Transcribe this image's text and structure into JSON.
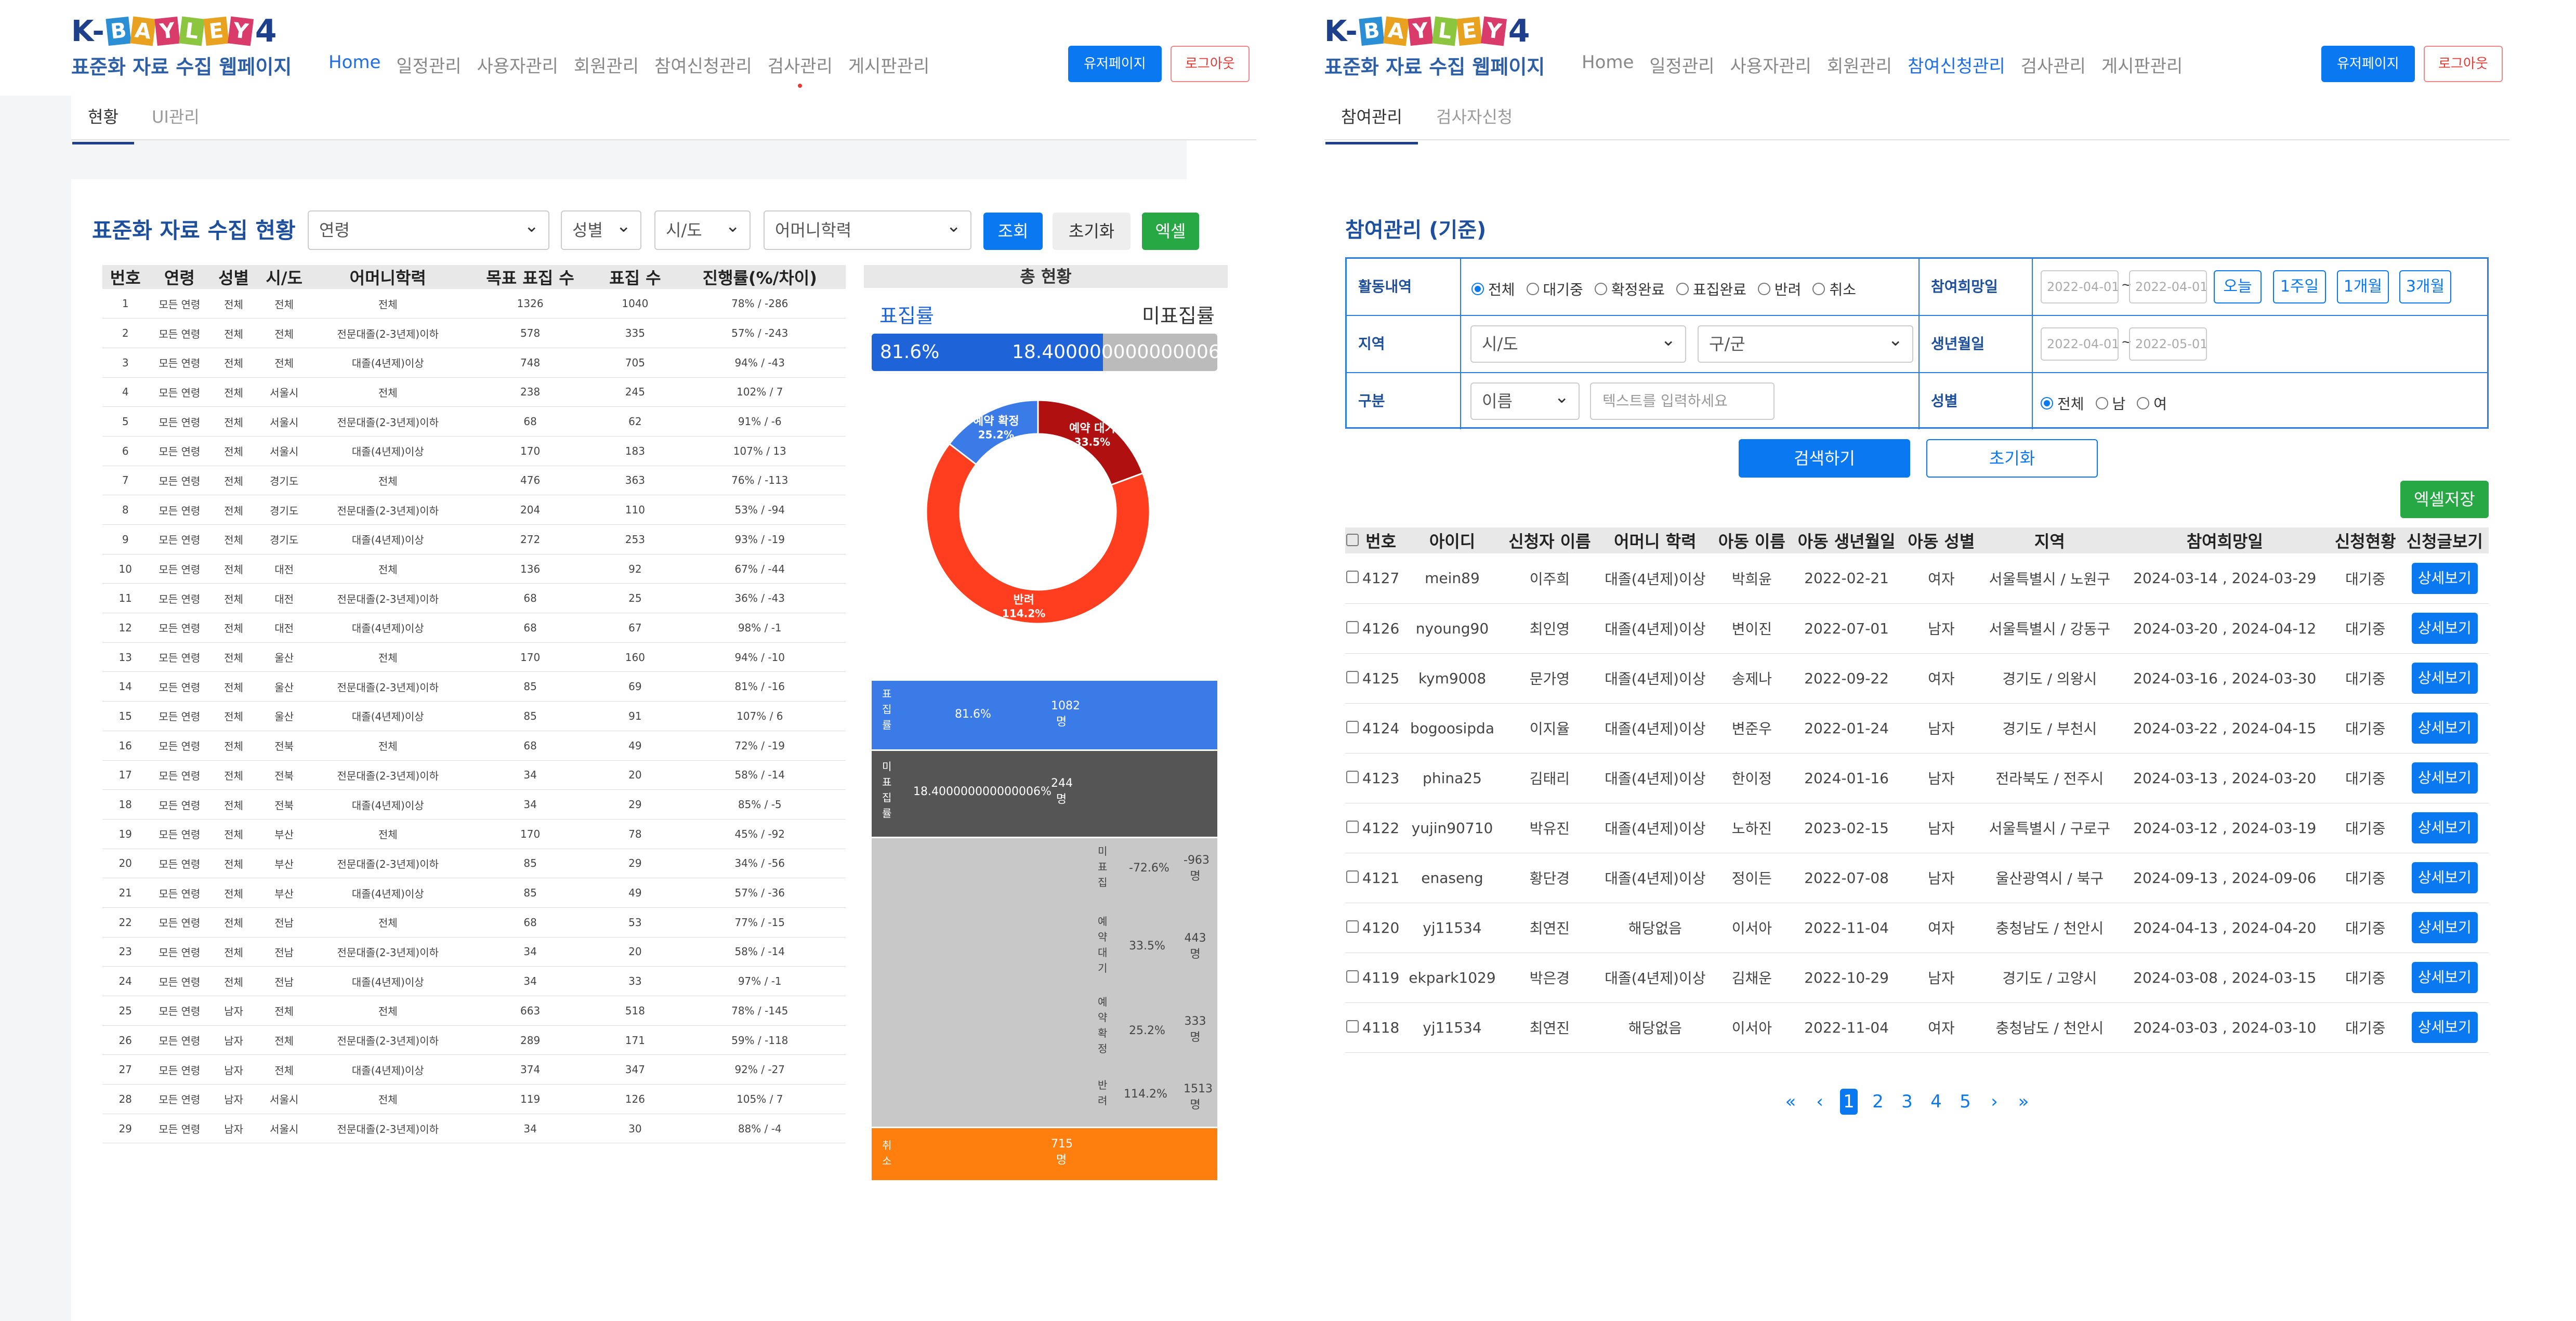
{
  "left": {
    "logo": {
      "brand": "K-BAYLEY4",
      "letters": [
        "B",
        "A",
        "Y",
        "L",
        "E",
        "Y"
      ],
      "subtitle": "표준화 자료 수집 웹페이지"
    },
    "nav": [
      "Home",
      "일정관리",
      "사용자관리",
      "회원관리",
      "참여신청관리",
      "검사관리",
      "게시판관리"
    ],
    "buttons": {
      "user_page": "유저페이지",
      "logout": "로그아웃"
    },
    "subtabs": [
      "현황",
      "UI관리"
    ],
    "title": "표준화 자료 수집 현황",
    "filters": {
      "age": "연령",
      "sex": "성별",
      "region": "시/도",
      "mother_edu": "어머니학력"
    },
    "actions": {
      "search": "조회",
      "reset": "초기화",
      "excel": "엑셀"
    },
    "table": {
      "headers": [
        "번호",
        "연령",
        "성별",
        "시/도",
        "어머니학력",
        "목표 표집 수",
        "표집 수",
        "진행률(%/차이)"
      ],
      "rows": [
        [
          "1",
          "모든 연령",
          "전체",
          "전체",
          "전체",
          "1326",
          "1040",
          "78% / -286"
        ],
        [
          "2",
          "모든 연령",
          "전체",
          "전체",
          "전문대졸(2-3년제)이하",
          "578",
          "335",
          "57% / -243"
        ],
        [
          "3",
          "모든 연령",
          "전체",
          "전체",
          "대졸(4년제)이상",
          "748",
          "705",
          "94% / -43"
        ],
        [
          "4",
          "모든 연령",
          "전체",
          "서울시",
          "전체",
          "238",
          "245",
          "102% / 7"
        ],
        [
          "5",
          "모든 연령",
          "전체",
          "서울시",
          "전문대졸(2-3년제)이하",
          "68",
          "62",
          "91% / -6"
        ],
        [
          "6",
          "모든 연령",
          "전체",
          "서울시",
          "대졸(4년제)이상",
          "170",
          "183",
          "107% / 13"
        ],
        [
          "7",
          "모든 연령",
          "전체",
          "경기도",
          "전체",
          "476",
          "363",
          "76% / -113"
        ],
        [
          "8",
          "모든 연령",
          "전체",
          "경기도",
          "전문대졸(2-3년제)이하",
          "204",
          "110",
          "53% / -94"
        ],
        [
          "9",
          "모든 연령",
          "전체",
          "경기도",
          "대졸(4년제)이상",
          "272",
          "253",
          "93% / -19"
        ],
        [
          "10",
          "모든 연령",
          "전체",
          "대전",
          "전체",
          "136",
          "92",
          "67% / -44"
        ],
        [
          "11",
          "모든 연령",
          "전체",
          "대전",
          "전문대졸(2-3년제)이하",
          "68",
          "25",
          "36% / -43"
        ],
        [
          "12",
          "모든 연령",
          "전체",
          "대전",
          "대졸(4년제)이상",
          "68",
          "67",
          "98% / -1"
        ],
        [
          "13",
          "모든 연령",
          "전체",
          "울산",
          "전체",
          "170",
          "160",
          "94% / -10"
        ],
        [
          "14",
          "모든 연령",
          "전체",
          "울산",
          "전문대졸(2-3년제)이하",
          "85",
          "69",
          "81% / -16"
        ],
        [
          "15",
          "모든 연령",
          "전체",
          "울산",
          "대졸(4년제)이상",
          "85",
          "91",
          "107% / 6"
        ],
        [
          "16",
          "모든 연령",
          "전체",
          "전북",
          "전체",
          "68",
          "49",
          "72% / -19"
        ],
        [
          "17",
          "모든 연령",
          "전체",
          "전북",
          "전문대졸(2-3년제)이하",
          "34",
          "20",
          "58% / -14"
        ],
        [
          "18",
          "모든 연령",
          "전체",
          "전북",
          "대졸(4년제)이상",
          "34",
          "29",
          "85% / -5"
        ],
        [
          "19",
          "모든 연령",
          "전체",
          "부산",
          "전체",
          "170",
          "78",
          "45% / -92"
        ],
        [
          "20",
          "모든 연령",
          "전체",
          "부산",
          "전문대졸(2-3년제)이하",
          "85",
          "29",
          "34% / -56"
        ],
        [
          "21",
          "모든 연령",
          "전체",
          "부산",
          "대졸(4년제)이상",
          "85",
          "49",
          "57% / -36"
        ],
        [
          "22",
          "모든 연령",
          "전체",
          "전남",
          "전체",
          "68",
          "53",
          "77% / -15"
        ],
        [
          "23",
          "모든 연령",
          "전체",
          "전남",
          "전문대졸(2-3년제)이하",
          "34",
          "20",
          "58% / -14"
        ],
        [
          "24",
          "모든 연령",
          "전체",
          "전남",
          "대졸(4년제)이상",
          "34",
          "33",
          "97% / -1"
        ],
        [
          "25",
          "모든 연령",
          "남자",
          "전체",
          "전체",
          "663",
          "518",
          "78% / -145"
        ],
        [
          "26",
          "모든 연령",
          "남자",
          "전체",
          "전문대졸(2-3년제)이하",
          "289",
          "171",
          "59% / -118"
        ],
        [
          "27",
          "모든 연령",
          "남자",
          "전체",
          "대졸(4년제)이상",
          "374",
          "347",
          "92% / -27"
        ],
        [
          "28",
          "모든 연령",
          "남자",
          "서울시",
          "전체",
          "119",
          "126",
          "105% / 7"
        ],
        [
          "29",
          "모든 연령",
          "남자",
          "서울시",
          "전문대졸(2-3년제)이하",
          "34",
          "30",
          "88% / -4"
        ]
      ]
    },
    "summary": {
      "header": "총 현황",
      "sample_label": "표집률",
      "unsample_label": "미표집률",
      "sample_rate": "81.6%",
      "unsample_rate": "18.400000000000006%",
      "sample_fraction": 0.816,
      "donut": [
        {
          "label": "예약 대기",
          "value": "33.5%",
          "pct": 33.5,
          "color": "#b01010"
        },
        {
          "label": "반려",
          "value": "114.2%",
          "pct": 114.2,
          "color": "#ff3d1f"
        },
        {
          "label": "예약 확정",
          "value": "25.2%",
          "pct": 25.2,
          "color": "#3b7be8"
        }
      ],
      "blocks": [
        {
          "label": "표집률",
          "pct": "81.6%",
          "count": "1082명"
        },
        {
          "label": "미표집률",
          "pct": "18.400000000000006%",
          "count": "244명"
        },
        {
          "label": "미표집",
          "pct": "-72.6%",
          "count": "-963명"
        },
        {
          "label": "예약대기",
          "pct": "33.5%",
          "count": "443명"
        },
        {
          "label": "예약확정",
          "pct": "25.2%",
          "count": "333명"
        },
        {
          "label": "반려",
          "pct": "114.2%",
          "count": "1513명"
        },
        {
          "label": "취소",
          "pct": "",
          "count": "715명"
        }
      ]
    }
  },
  "right": {
    "nav": [
      "Home",
      "일정관리",
      "사용자관리",
      "회원관리",
      "참여신청관리",
      "검사관리",
      "게시판관리"
    ],
    "subtabs": [
      "참여관리",
      "검사자신청"
    ],
    "title": "참여관리 (기준)",
    "form": {
      "activity_label": "활동내역",
      "activity_options": [
        "전체",
        "대기중",
        "확정완료",
        "표집완료",
        "반려",
        "취소"
      ],
      "date_label": "참여희망일",
      "date_from": "2022-04-01",
      "date_to": "2022-04-01",
      "period_buttons": [
        "오늘",
        "1주일",
        "1개월",
        "3개월"
      ],
      "region_label": "지역",
      "region_sido": "시/도",
      "region_gugun": "구/군",
      "birth_label": "생년월일",
      "birth_from": "2022-04-01",
      "birth_to": "2022-05-01",
      "type_label": "구분",
      "type_select": "이름",
      "text_placeholder": "텍스트를 입력하세요",
      "sex_label": "성별",
      "sex_options": [
        "전체",
        "남",
        "여"
      ]
    },
    "search_button": "검색하기",
    "reset_button": "초기화",
    "excel_button": "엑셀저장",
    "table": {
      "headers": [
        "번호",
        "아이디",
        "신청자 이름",
        "어머니 학력",
        "아동 이름",
        "아동 생년월일",
        "아동 성별",
        "지역",
        "참여희망일",
        "신청현황",
        "신청글보기"
      ],
      "rows": [
        [
          "4127",
          "mein89",
          "이주희",
          "대졸(4년제)이상",
          "박희윤",
          "2022-02-21",
          "여자",
          "서울특별시 / 노원구",
          "2024-03-14 , 2024-03-29",
          "대기중"
        ],
        [
          "4126",
          "nyoung90",
          "최인영",
          "대졸(4년제)이상",
          "변이진",
          "2022-07-01",
          "남자",
          "서울특별시 / 강동구",
          "2024-03-20 , 2024-04-12",
          "대기중"
        ],
        [
          "4125",
          "kym9008",
          "문가영",
          "대졸(4년제)이상",
          "송제나",
          "2022-09-22",
          "여자",
          "경기도 / 의왕시",
          "2024-03-16 , 2024-03-30",
          "대기중"
        ],
        [
          "4124",
          "bogoosipda",
          "이지율",
          "대졸(4년제)이상",
          "변준우",
          "2022-01-24",
          "남자",
          "경기도 / 부천시",
          "2024-03-22 , 2024-04-15",
          "대기중"
        ],
        [
          "4123",
          "phina25",
          "김태리",
          "대졸(4년제)이상",
          "한이정",
          "2024-01-16",
          "남자",
          "전라북도 / 전주시",
          "2024-03-13 , 2024-03-20",
          "대기중"
        ],
        [
          "4122",
          "yujin90710",
          "박유진",
          "대졸(4년제)이상",
          "노하진",
          "2023-02-15",
          "남자",
          "서울특별시 / 구로구",
          "2024-03-12 , 2024-03-19",
          "대기중"
        ],
        [
          "4121",
          "enaseng",
          "황단경",
          "대졸(4년제)이상",
          "정이든",
          "2022-07-08",
          "남자",
          "울산광역시 / 북구",
          "2024-09-13 , 2024-09-06",
          "대기중"
        ],
        [
          "4120",
          "yj11534",
          "최연진",
          "해당없음",
          "이서아",
          "2022-11-04",
          "여자",
          "충청남도 / 천안시",
          "2024-04-13 , 2024-04-20",
          "대기중"
        ],
        [
          "4119",
          "ekpark1029",
          "박은경",
          "대졸(4년제)이상",
          "김채운",
          "2022-10-29",
          "남자",
          "경기도 / 고양시",
          "2024-03-08 , 2024-03-15",
          "대기중"
        ],
        [
          "4118",
          "yj11534",
          "최연진",
          "해당없음",
          "이서아",
          "2022-11-04",
          "여자",
          "충청남도 / 천안시",
          "2024-03-03 , 2024-03-10",
          "대기중"
        ]
      ],
      "detail_label": "상세보기"
    },
    "pagination": {
      "pages": [
        "1",
        "2",
        "3",
        "4",
        "5"
      ],
      "current": "1",
      "first": "«",
      "prev": "‹",
      "next": "›",
      "last": "»"
    }
  },
  "colors": {
    "primary": "#0a78f0",
    "brand": "#1d3f8c",
    "green": "#28a745",
    "block_blue": "#3b7be8",
    "block_dark": "#555555",
    "block_gray": "#c8c8c8",
    "block_orange": "#ff7f0e"
  }
}
